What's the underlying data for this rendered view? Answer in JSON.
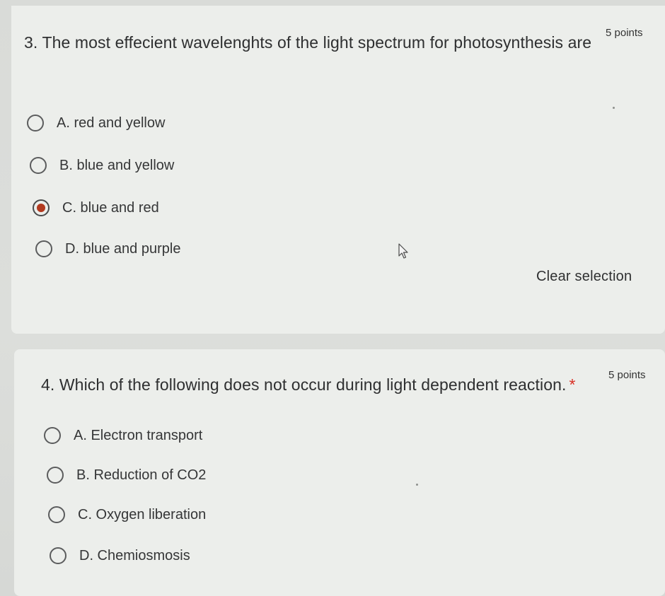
{
  "questions": [
    {
      "number_title": "3. The most effecient wavelenghts of the light spectrum for photosynthesis are",
      "points": "5 points",
      "options": [
        {
          "label": "A. red and yellow",
          "selected": false
        },
        {
          "label": "B. blue and yellow",
          "selected": false
        },
        {
          "label": "C. blue and red",
          "selected": true
        },
        {
          "label": "D. blue and purple",
          "selected": false
        }
      ],
      "clear_label": "Clear selection"
    },
    {
      "number_title": "4. Which of the following does not occur during light dependent reaction.",
      "required_mark": "*",
      "points": "5 points",
      "options": [
        {
          "label": "A. Electron transport",
          "selected": false
        },
        {
          "label": "B. Reduction of CO2",
          "selected": false
        },
        {
          "label": "C. Oxygen liberation",
          "selected": false
        },
        {
          "label": "D. Chemiosmosis",
          "selected": false
        }
      ]
    }
  ],
  "colors": {
    "selected_radio": "#b23a1f",
    "required_star": "#d93025"
  },
  "icons": {
    "cursor": "mouse-pointer-icon",
    "radio_unselected": "radio-empty-icon",
    "radio_selected": "radio-filled-icon"
  }
}
